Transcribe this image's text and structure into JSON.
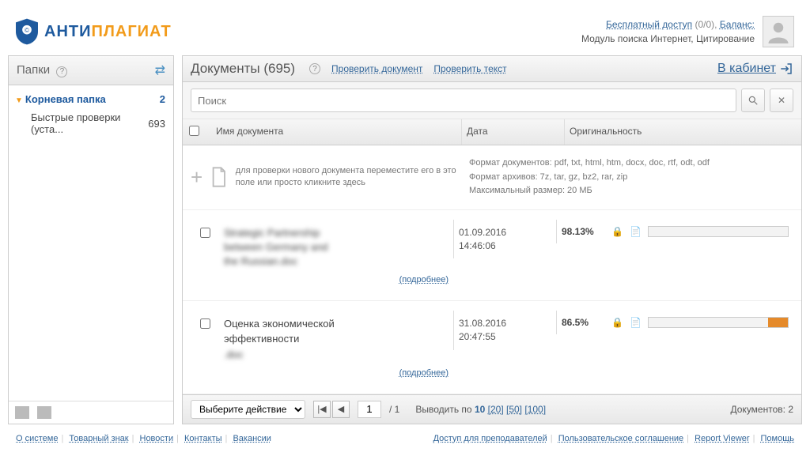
{
  "header": {
    "logo_anti": "АНТИ",
    "logo_plagiat": "ПЛАГИАТ",
    "free_access": "Бесплатный доступ",
    "free_count": "(0/0),",
    "balance": "Баланс:",
    "module_info": "Модуль поиска Интернет, Цитирование"
  },
  "sidebar": {
    "title": "Папки",
    "root": {
      "label": "Корневая папка",
      "count": "2"
    },
    "child": {
      "label": "Быстрые проверки (уста...",
      "count": "693"
    }
  },
  "main": {
    "title": "Документы (695)",
    "check_doc": "Проверить документ",
    "check_text": "Проверить текст",
    "cabinet": "В кабинет",
    "search_placeholder": "Поиск",
    "col_name": "Имя документа",
    "col_date": "Дата",
    "col_orig": "Оригинальность"
  },
  "upload": {
    "text": "для проверки нового документа переместите его в это поле или просто кликните здесь",
    "formats_doc": "Формат документов: pdf, txt, html, htm, docx, doc, rtf, odt, odf",
    "formats_arch": "Формат архивов: 7z, tar, gz, bz2, rar, zip",
    "max_size": "Максимальный размер: 20 МБ"
  },
  "docs": [
    {
      "title_l1": "Strategic Partnership",
      "title_l2": "between Germany and",
      "title_l3": "the Russian.doc",
      "date_d": "01.09.2016",
      "date_t": "14:46:06",
      "orig": "98.13%",
      "fill": "2%"
    },
    {
      "title_l1": "Оценка экономической",
      "title_l2": "эффективности",
      "title_l3": ".doc",
      "date_d": "31.08.2016",
      "date_t": "20:47:55",
      "orig": "86.5%",
      "fill": "14%"
    }
  ],
  "details_label": "(подробнее)",
  "foot": {
    "action": "Выберите действие",
    "page": "1",
    "total": "/ 1",
    "per_label": "Выводить по",
    "per_10": "10",
    "per_20": "[20]",
    "per_50": "[50]",
    "per_100": "[100]",
    "docs_count": "Документов: 2"
  },
  "footer": {
    "left": {
      "about": "О системе",
      "trademark": "Товарный знак",
      "news": "Новости",
      "contacts": "Контакты",
      "vacancies": "Вакансии"
    },
    "right": {
      "teachers": "Доступ для преподавателей",
      "agreement": "Пользовательское соглашение",
      "report": "Report Viewer",
      "help": "Помощь"
    }
  }
}
